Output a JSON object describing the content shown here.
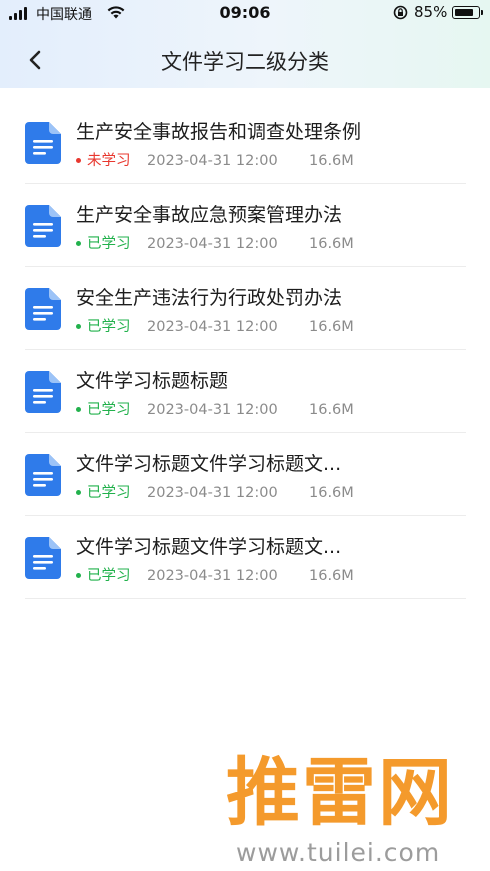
{
  "status_bar": {
    "carrier": "中国联通",
    "time": "09:06",
    "battery": "85%",
    "battery_level": 0.85
  },
  "header": {
    "title": "文件学习二级分类"
  },
  "colors": {
    "learned": "#22b14c",
    "unlearned": "#e8382f",
    "doc_icon": "#2f7bea"
  },
  "files": [
    {
      "title": "生产安全事故报告和调查处理条例",
      "status": "未学习",
      "learned": false,
      "date": "2023-04-31 12:00",
      "size": "16.6M"
    },
    {
      "title": "生产安全事故应急预案管理办法",
      "status": "已学习",
      "learned": true,
      "date": "2023-04-31 12:00",
      "size": "16.6M"
    },
    {
      "title": "安全生产违法行为行政处罚办法",
      "status": "已学习",
      "learned": true,
      "date": "2023-04-31 12:00",
      "size": "16.6M"
    },
    {
      "title": "文件学习标题标题",
      "status": "已学习",
      "learned": true,
      "date": "2023-04-31 12:00",
      "size": "16.6M"
    },
    {
      "title": "文件学习标题文件学习标题文...",
      "status": "已学习",
      "learned": true,
      "date": "2023-04-31 12:00",
      "size": "16.6M"
    },
    {
      "title": "文件学习标题文件学习标题文...",
      "status": "已学习",
      "learned": true,
      "date": "2023-04-31 12:00",
      "size": "16.6M"
    }
  ],
  "watermark": {
    "text": "推雷网",
    "url": "www.tuilei.com"
  }
}
